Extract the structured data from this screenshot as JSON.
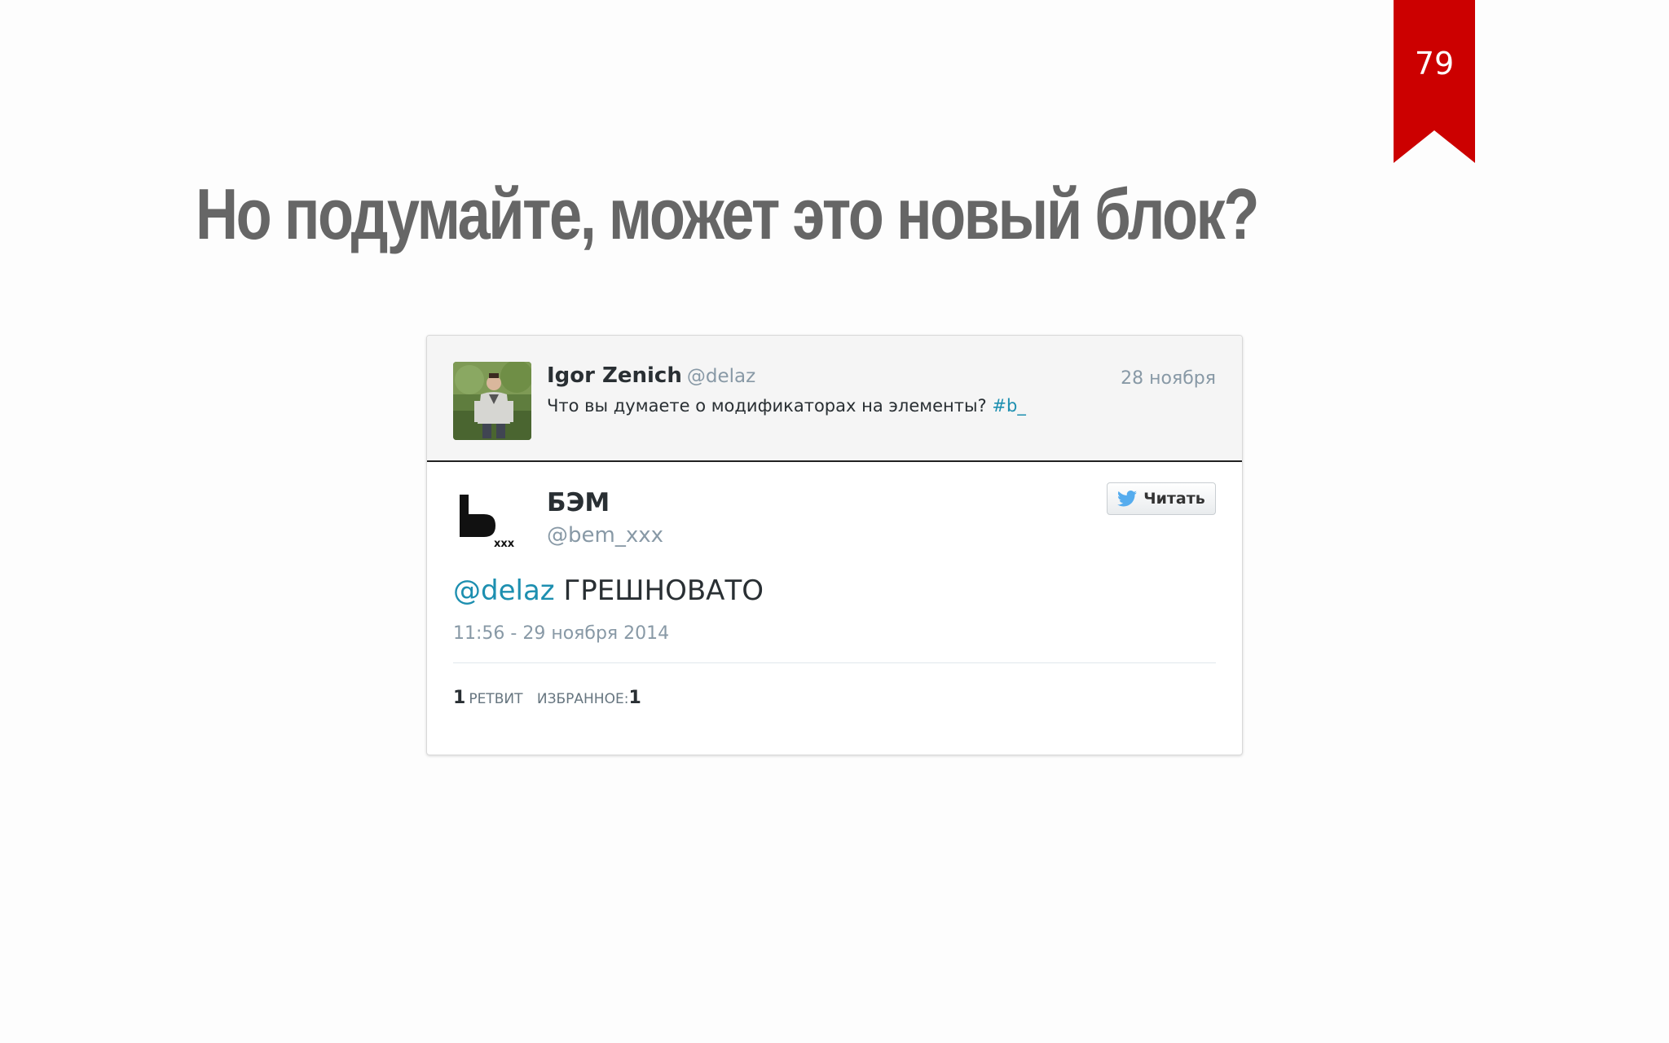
{
  "slide": {
    "number": "79",
    "title": "Но подумайте, может это новый блок?",
    "accent_color": "#cc0000"
  },
  "reply_tweet": {
    "author_name": "Igor Zenich",
    "author_handle": "@delaz",
    "date": "28 ноября",
    "text": "Что вы думаете о модификаторах на элементы?",
    "hashtag": "#b_"
  },
  "main_tweet": {
    "author_name": "БЭМ",
    "author_handle": "@bem_xxx",
    "logo_subscript": "xxx",
    "follow_label": "Читать",
    "mention": "@delaz",
    "text": "ГРЕШНОВАТО",
    "timestamp": "11:56 - 29 ноября 2014",
    "retweets_count": "1",
    "retweets_label": "ретвит",
    "favorites_label": "избранное:",
    "favorites_count": "1",
    "link_color": "#1d8fb0"
  }
}
